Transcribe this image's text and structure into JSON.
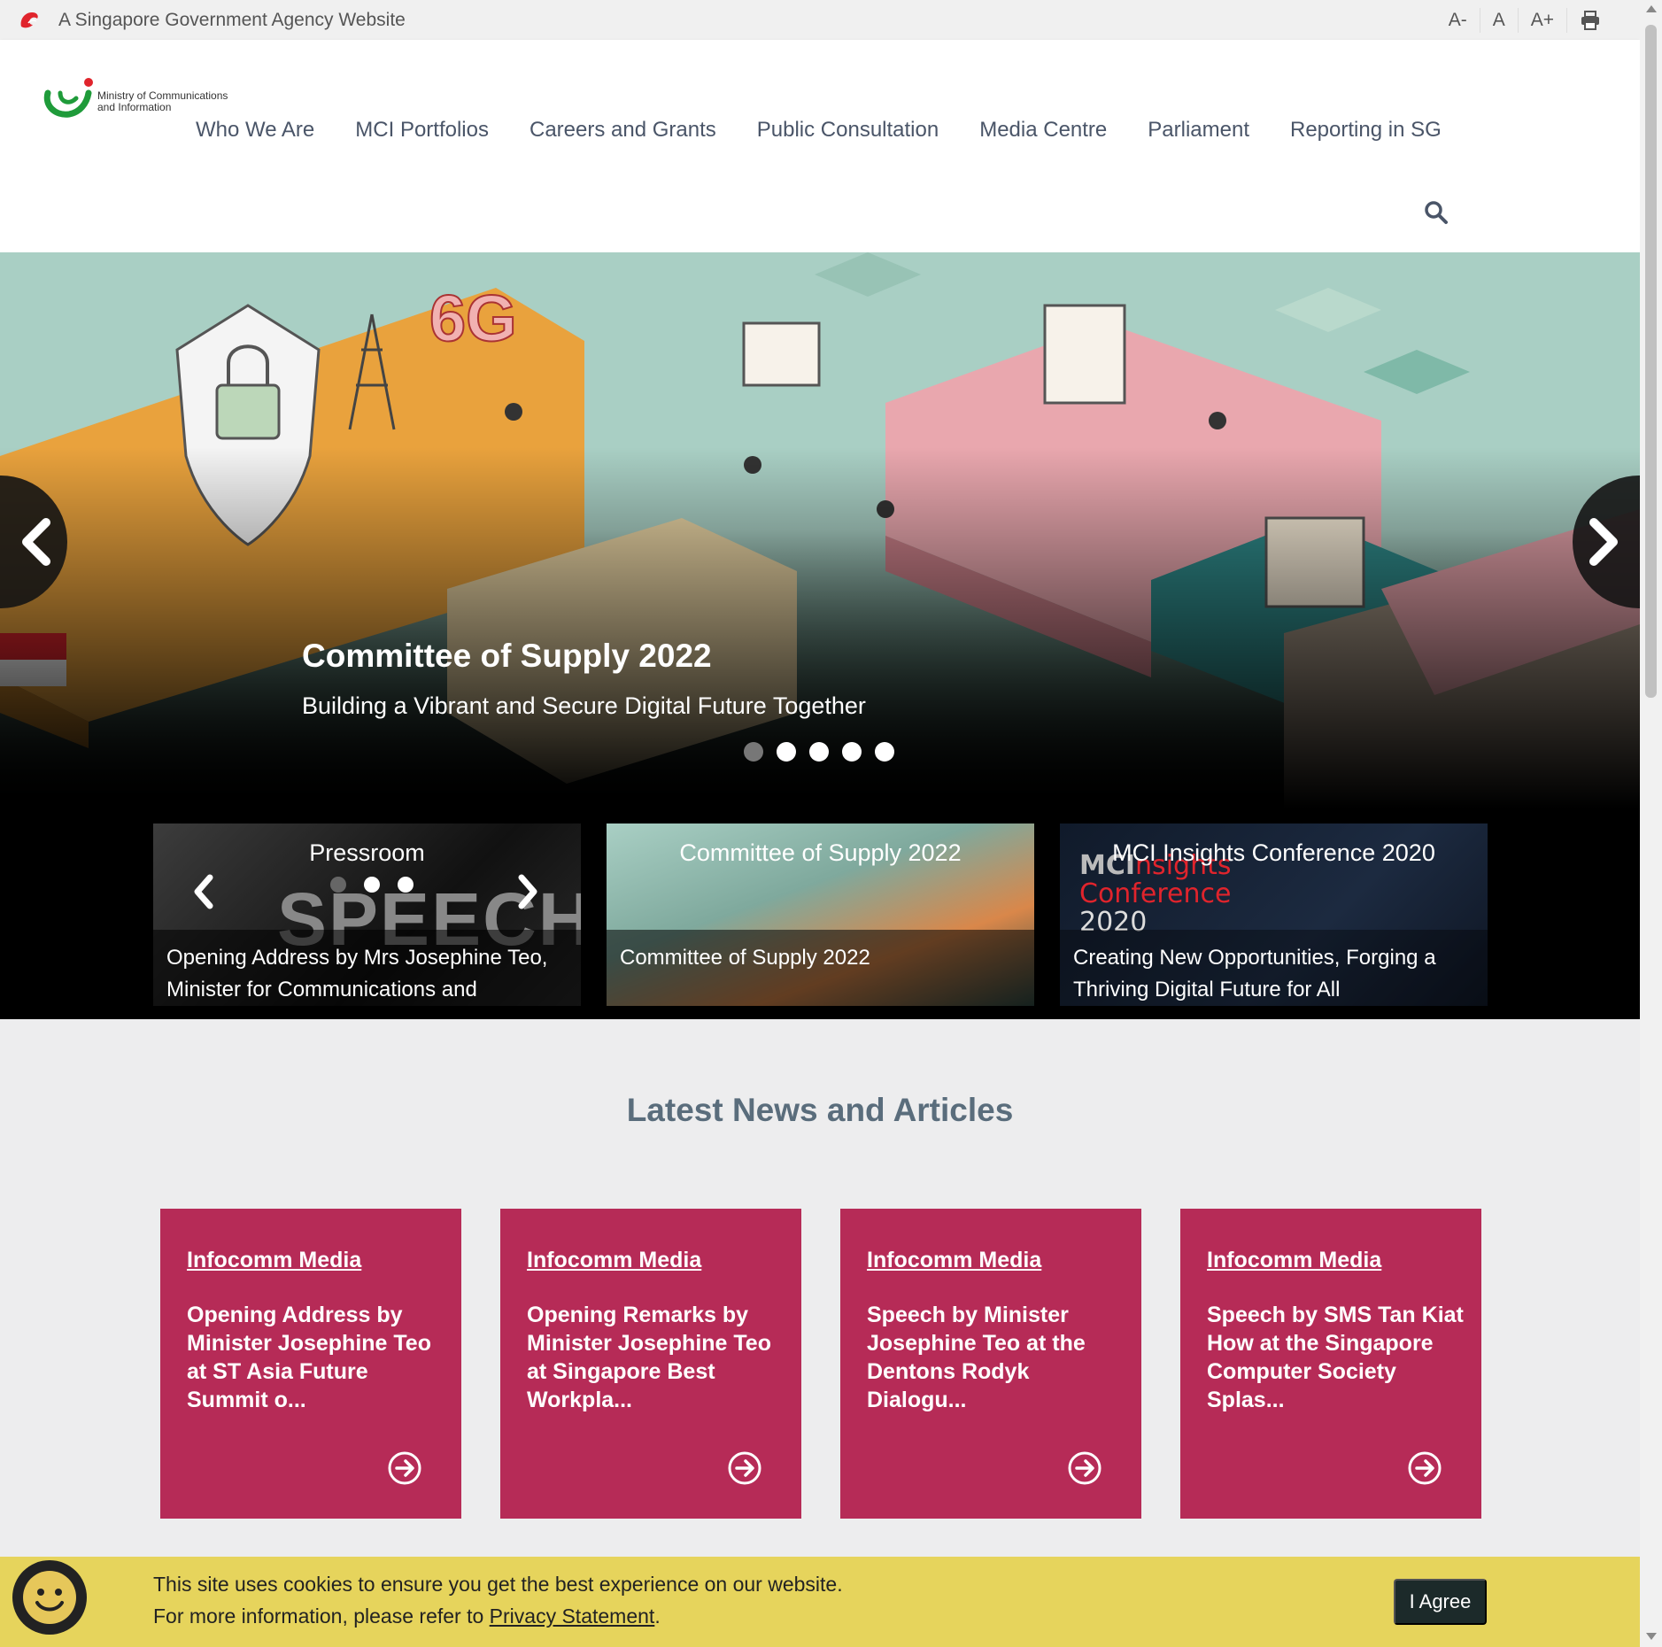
{
  "gov_bar": {
    "text": "A Singapore Government Agency Website",
    "font_small": "A-",
    "font_normal": "A",
    "font_large": "A+",
    "print_icon": "print-icon"
  },
  "logo": {
    "line1": "Ministry of Communications",
    "line2": "and Information"
  },
  "nav": {
    "items": [
      "Who We Are",
      "MCI Portfolios",
      "Careers and Grants",
      "Public Consultation",
      "Media Centre",
      "Parliament",
      "Reporting in SG"
    ],
    "search_icon": "search-icon"
  },
  "hero": {
    "title": "Committee of Supply 2022",
    "subtitle": "Building a Vibrant and Secure Digital Future Together",
    "dot_count": 5,
    "active_dot": 0
  },
  "features": [
    {
      "heading": "Pressroom",
      "body": "Opening Address by Mrs Josephine Teo, Minister for Communications and",
      "bg_word": "SPEECH"
    },
    {
      "heading": "Committee of Supply 2022",
      "body": "Committee of Supply 2022"
    },
    {
      "heading": "MCI Insights Conference 2020",
      "body": "Creating New Opportunities, Forging a Thriving Digital Future for All",
      "bg_text_1": "MCI",
      "bg_text_2": "nsights",
      "bg_text_3": "Conference",
      "bg_text_4": "2020"
    }
  ],
  "news": {
    "heading": "Latest News and Articles",
    "items": [
      {
        "category": "Infocomm Media",
        "title": "Opening Address by Minister Josephine Teo at ST Asia Future Summit o..."
      },
      {
        "category": "Infocomm Media",
        "title": "Opening Remarks by Minister Josephine Teo at Singapore Best Workpla..."
      },
      {
        "category": "Infocomm Media",
        "title": "Speech by Minister Josephine Teo at the Dentons Rodyk Dialogu..."
      },
      {
        "category": "Infocomm Media",
        "title": "Speech by SMS Tan Kiat How at the Singapore Computer Society Splas..."
      }
    ]
  },
  "cookie": {
    "line1": "This site uses cookies to ensure you get the best experience on our website.",
    "line2_prefix": "For more information, please refer to ",
    "link": "Privacy Statement",
    "line2_suffix": ".",
    "button": "I Agree"
  },
  "colors": {
    "news_card": "#b62b57",
    "cookie_bg": "#e6d45c",
    "agree_btn": "#1c2a2a",
    "heading": "#5a6d7c"
  }
}
